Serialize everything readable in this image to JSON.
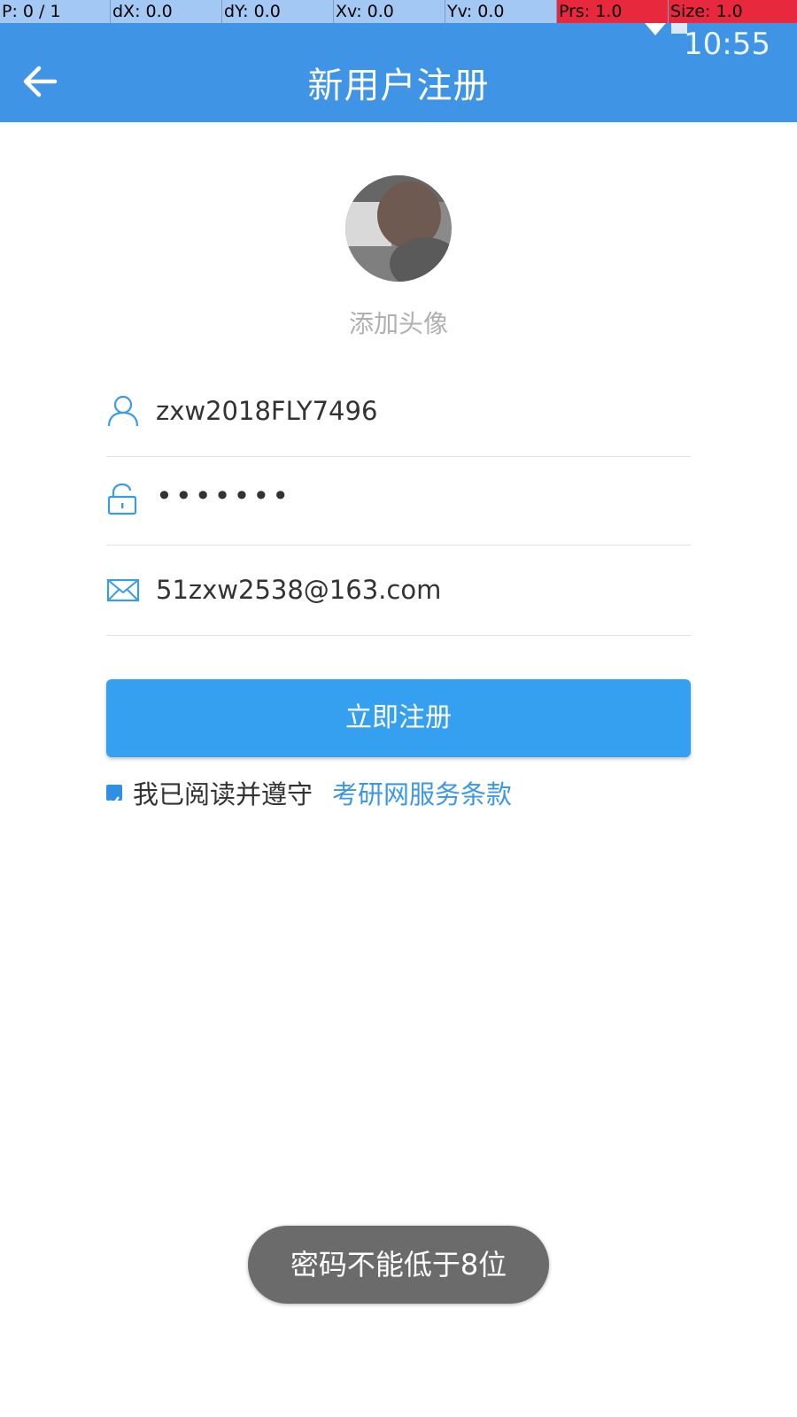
{
  "debug_bar": {
    "p": "P: 0 / 1",
    "dx": "dX: 0.0",
    "dy": "dY: 0.0",
    "xv": "Xv: 0.0",
    "yv": "Yv: 0.0",
    "prs": "Prs: 1.0",
    "size": "Size: 1.0"
  },
  "status_bar": {
    "time": "10:55"
  },
  "header": {
    "title": "新用户注册",
    "back_icon": "arrow-left-icon"
  },
  "avatar": {
    "label": "添加头像"
  },
  "form": {
    "username": "zxw2018FLY7496",
    "password_mask": "•••••••",
    "email": "51zxw2538@163.com"
  },
  "submit": {
    "label": "立即注册"
  },
  "agreement": {
    "checked": true,
    "text": "我已阅读并遵守",
    "link": "考研网服务条款"
  },
  "toast": {
    "message": "密码不能低于8位"
  },
  "colors": {
    "header": "#3f94e5",
    "button": "#359ff0",
    "link": "#3c97e6",
    "toast": "#6b6b6b"
  }
}
